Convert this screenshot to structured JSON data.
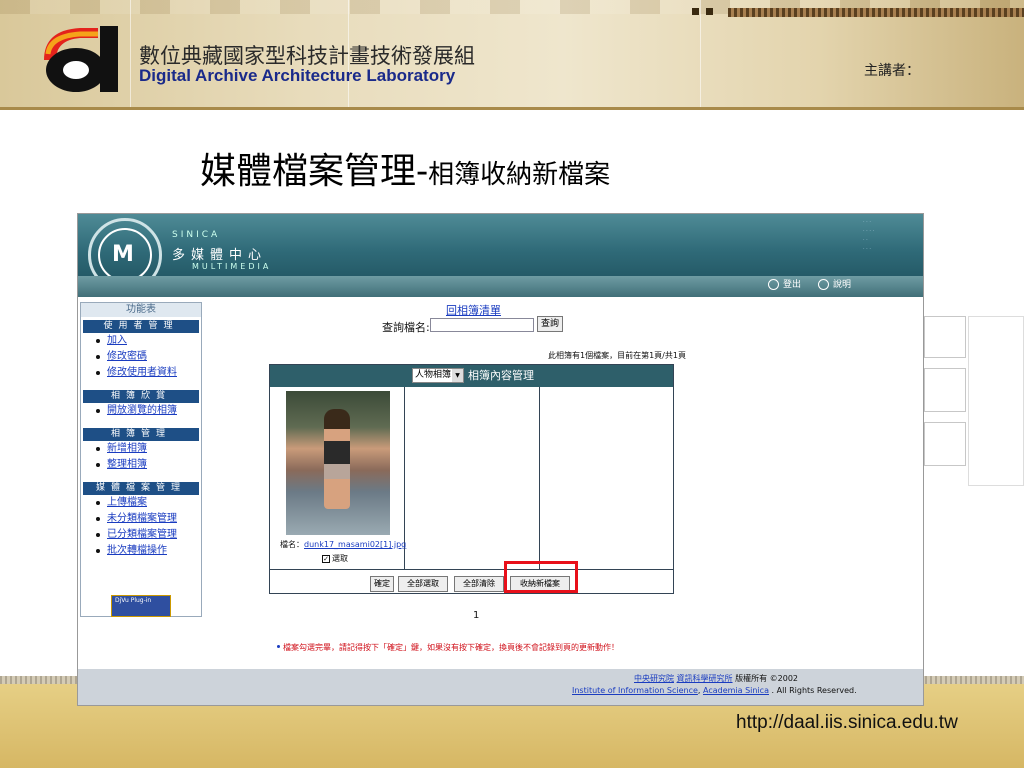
{
  "header": {
    "org_zh": "數位典藏國家型科技計畫技術發展組",
    "org_en": "Digital Archive Architecture Laboratory",
    "speaker_label": "主講者："
  },
  "slide": {
    "title_main": "媒體檔案管理-",
    "title_sub": "相簿收納新檔案",
    "url": "http://daal.iis.sinica.edu.tw"
  },
  "app": {
    "banner": {
      "sinica": "SINICA",
      "title_zh": "多媒體中心",
      "multimedia": "MULTIMEDIA",
      "logout": "登出",
      "help": "說明"
    },
    "sidebar": {
      "header": "功能表",
      "sections": [
        {
          "title": "使用者管理",
          "items": [
            "加入",
            "修改密碼",
            "修改使用者資料"
          ]
        },
        {
          "title": "相簿欣賞",
          "items": [
            "開放瀏覽的相簿"
          ]
        },
        {
          "title": "相簿管理",
          "items": [
            "新增相簿",
            "整理相簿"
          ]
        },
        {
          "title": "媒體檔案管理",
          "items": [
            "上傳檔案",
            "未分類檔案管理",
            "已分類檔案管理",
            "批次轉檔操作"
          ]
        }
      ],
      "plugin_badge": "DjVu Plug-in"
    },
    "main": {
      "back_link": "回相簿清單",
      "search_label": "查詢檔名:",
      "search_value": "",
      "search_button": "查詢",
      "info": "此相簿有1個檔案，目前在第1頁/共1頁",
      "album_select": "人物相簿",
      "panel_title": "相簿內容管理",
      "file_label": "檔名：",
      "file_name": "dunk17_masami02[1].jpg",
      "checkbox_checked": true,
      "checkbox_label": "選取",
      "buttons": {
        "confirm": "確定",
        "select_all": "全部選取",
        "clear_all": "全部清除",
        "collect": "收納新檔案"
      },
      "page": "1",
      "note": "檔案勾選完畢，請記得按下「確定」鍵，如果沒有按下確定，換頁後不會記錄到頁的更新動作！"
    },
    "footer": {
      "org1": "中央研究院",
      "org2": "資訊科學研究所",
      "rights_zh": "版權所有 ©2002",
      "inst_en": "Institute of Information Science",
      "sep": ",",
      "acad_en": "Academia Sinica",
      "rights_en": ". All Rights Reserved."
    }
  }
}
